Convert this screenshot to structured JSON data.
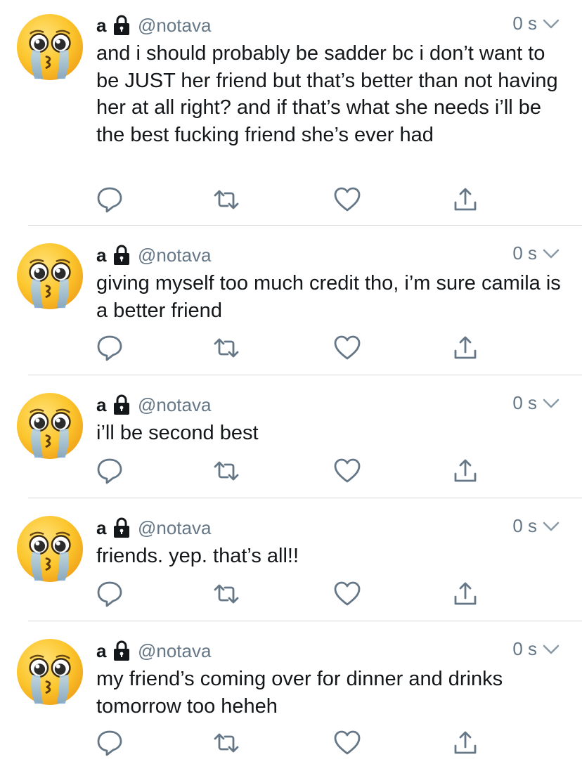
{
  "colors": {
    "text": "#14171a",
    "secondary": "#657786",
    "divider": "#d4d6d9",
    "icon": "#657786"
  },
  "icons": {
    "avatar": "crying-face-emoji-avatar",
    "lock": "lock-icon",
    "caret": "chevron-down-icon",
    "reply": "reply-icon",
    "retweet": "retweet-icon",
    "like": "heart-icon",
    "share": "share-icon"
  },
  "tweets": [
    {
      "name": "a",
      "handle": "@notava",
      "time": "0 s",
      "text": "and i should probably be sadder bc i don’t want to be JUST her friend but that’s better than not having her at all right? and if that’s what she needs i’ll be the best fucking friend she’s ever had"
    },
    {
      "name": "a",
      "handle": "@notava",
      "time": "0 s",
      "text": "giving myself too much credit tho, i’m sure camila is a better friend"
    },
    {
      "name": "a",
      "handle": "@notava",
      "time": "0 s",
      "text": "i’ll be second best"
    },
    {
      "name": "a",
      "handle": "@notava",
      "time": "0 s",
      "text": "friends. yep. that’s all!!"
    },
    {
      "name": "a",
      "handle": "@notava",
      "time": "0 s",
      "text": "my friend’s coming over for dinner and drinks tomorrow too heheh"
    }
  ]
}
